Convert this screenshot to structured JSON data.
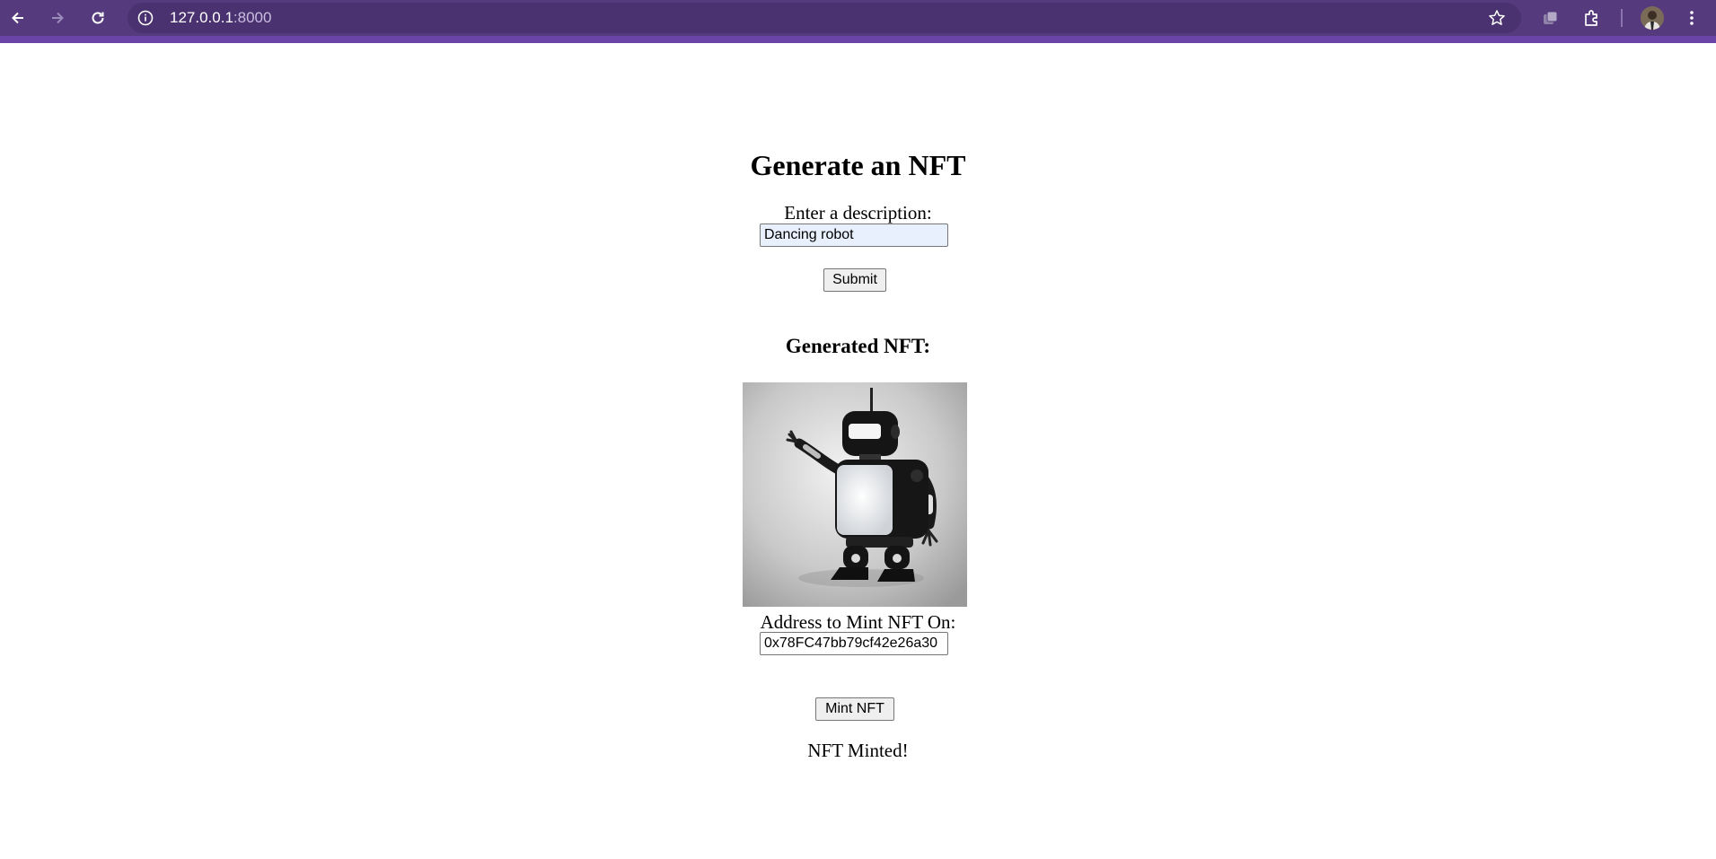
{
  "browser": {
    "url_host": "127.0.0.1",
    "url_port": ":8000",
    "theme_color": "#553a7e"
  },
  "page": {
    "title": "Generate an NFT",
    "description_label": "Enter a description:",
    "description_value": "Dancing robot",
    "submit_label": "Submit",
    "result_heading": "Generated NFT:",
    "image_subject": "robot",
    "address_label": "Address to Mint NFT On:",
    "address_value": "0x78FC47bb79cf42e26a30",
    "mint_label": "Mint NFT",
    "status_text": "NFT Minted!"
  },
  "icons": [
    "back-icon",
    "forward-icon",
    "reload-icon",
    "info-icon",
    "star-icon",
    "tab-search-icon",
    "extensions-icon",
    "avatar",
    "menu-icon"
  ]
}
